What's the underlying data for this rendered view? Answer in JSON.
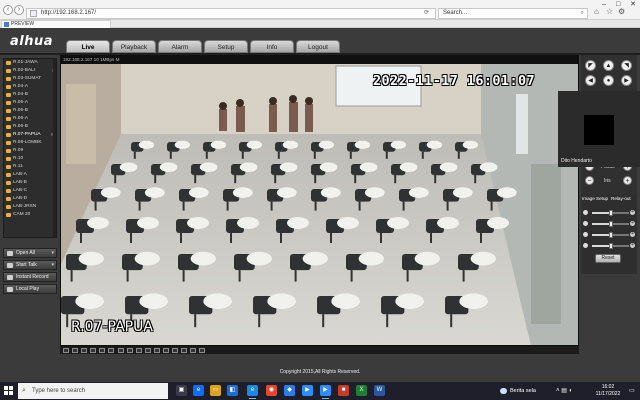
{
  "browser": {
    "url": "http://192.168.2.167/",
    "tab_title": "PREVIEW",
    "search_placeholder": "Search...",
    "window_controls": [
      "–",
      "□",
      "✕"
    ]
  },
  "app": {
    "brand": "alhua",
    "tabs": [
      "Live",
      "Playback",
      "Alarm",
      "Setup",
      "Info",
      "Logout"
    ],
    "active_tab": "Live"
  },
  "channels": [
    {
      "label": "R.01-JAWA",
      "stream": ""
    },
    {
      "label": "R.02-BALI",
      "stream": "S"
    },
    {
      "label": "R.03-SUMAT",
      "stream": ""
    },
    {
      "label": "R.04-A",
      "stream": ""
    },
    {
      "label": "R.04-B",
      "stream": ""
    },
    {
      "label": "R.05-A",
      "stream": ""
    },
    {
      "label": "R.05-B",
      "stream": ""
    },
    {
      "label": "R.06-A",
      "stream": ""
    },
    {
      "label": "R.06-B",
      "stream": ""
    },
    {
      "label": "R.07-PAPUA",
      "stream": "M"
    },
    {
      "label": "R.08-LOMBK",
      "stream": ""
    },
    {
      "label": "R.09",
      "stream": ""
    },
    {
      "label": "R.10",
      "stream": ""
    },
    {
      "label": "R.11",
      "stream": ""
    },
    {
      "label": "LAB-A",
      "stream": ""
    },
    {
      "label": "LAB-B",
      "stream": ""
    },
    {
      "label": "LAB-C",
      "stream": ""
    },
    {
      "label": "LAB-D",
      "stream": ""
    },
    {
      "label": "LAB-JRSN",
      "stream": ""
    },
    {
      "label": "CAM 20",
      "stream": ""
    }
  ],
  "left_actions": {
    "open_all": "Open All",
    "start_talk": "Start Talk",
    "instant_record": "Instant Record",
    "local_play": "Local Play"
  },
  "video": {
    "info_bar": "192.168.2.167 10 1MBps M",
    "osd_datetime": "2022-11-17  16:01:07",
    "osd_name": "R.07-PAPUA"
  },
  "participant": {
    "name": "Dito Hendarto"
  },
  "ptz": {
    "focus_label": "Focus",
    "iris_label": "Iris"
  },
  "image_setup": {
    "tab_image": "Image Setup",
    "tab_relay": "Relay-out",
    "brightness": 0.5,
    "contrast": 0.5,
    "saturation": 0.5,
    "hue": 0.5,
    "reset_label": "Reset"
  },
  "footer": {
    "copyright": "Copyright 2015,All Rights Reserved."
  },
  "taskbar": {
    "search_placeholder": "Type here to search",
    "weather": "Berita sela",
    "time": "16:02",
    "date": "11/17/2022"
  },
  "colors": {
    "accent": "#e2b23b",
    "chrome_bg": "#3b3b3b",
    "taskbar_bg": "#1f1f2b"
  }
}
